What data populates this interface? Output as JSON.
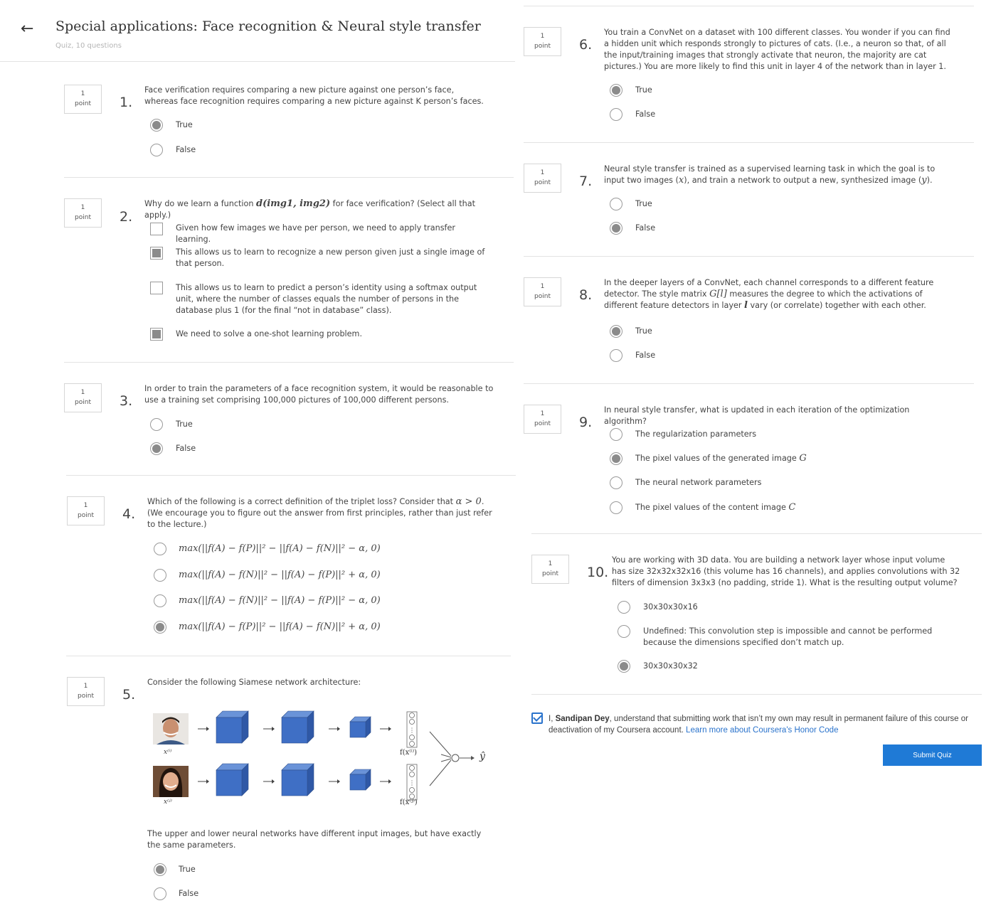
{
  "header": {
    "title": "Special applications: Face recognition & Neural style transfer",
    "subtitle": "Quiz, 10 questions"
  },
  "points": {
    "value": "1",
    "unit": "point"
  },
  "questions": [
    {
      "num": "1.",
      "text": "Face verification requires comparing a new picture against one person’s face, whereas face recognition requires comparing a new picture against K person’s faces.",
      "options": [
        {
          "label": "True",
          "selected": true
        },
        {
          "label": "False",
          "selected": false
        }
      ]
    },
    {
      "num": "2.",
      "text_pre": "Why do we learn a function ",
      "text_math": "d(img1, img2)",
      "text_post": " for face verification? (Select all that apply.)",
      "options": [
        {
          "label": "Given how few images we have per person, we need to apply transfer learning.",
          "selected": false
        },
        {
          "label": "This allows us to learn to recognize a new person given just a single image of that person.",
          "selected": true
        },
        {
          "label": "This allows us to learn to predict a person’s identity using a softmax output unit, where the number of classes equals the number of persons in the database plus 1 (for the final “not in database” class).",
          "selected": false
        },
        {
          "label": "We need to solve a one-shot learning problem.",
          "selected": true
        }
      ]
    },
    {
      "num": "3.",
      "text": "In order to train the parameters of a face recognition system, it would be reasonable to use a training set comprising 100,000 pictures of 100,000 different persons.",
      "options": [
        {
          "label": "True",
          "selected": false
        },
        {
          "label": "False",
          "selected": true
        }
      ]
    },
    {
      "num": "4.",
      "text_pre": "Which of the following is a correct definition of the triplet loss? Consider that ",
      "text_math": "α > 0",
      "text_post": ". (We encourage you to figure out the answer from first principles, rather than just refer to the lecture.)",
      "options": [
        {
          "label": "max(||f(A) − f(P)||² − ||f(A) − f(N)||² − α, 0)",
          "selected": false
        },
        {
          "label": "max(||f(A) − f(N)||² − ||f(A) − f(P)||² + α, 0)",
          "selected": false
        },
        {
          "label": "max(||f(A) − f(N)||² − ||f(A) − f(P)||² − α, 0)",
          "selected": false
        },
        {
          "label": "max(||f(A) − f(P)||² − ||f(A) − f(N)||² + α, 0)",
          "selected": true
        }
      ]
    },
    {
      "num": "5.",
      "text": "Consider the following Siamese network architecture:",
      "diagram": {
        "x_top": "x⁽ⁱ⁾",
        "x_bottom": "x⁽ʲ⁾",
        "f_top": "f(x⁽ⁱ⁾)",
        "f_bottom": "f(x⁽ʲ⁾)",
        "y_hat": "ŷ"
      },
      "text2": "The upper and lower neural networks have different input images, but have exactly the same parameters.",
      "options": [
        {
          "label": "True",
          "selected": true
        },
        {
          "label": "False",
          "selected": false
        }
      ]
    },
    {
      "num": "6.",
      "text": "You train a ConvNet on a dataset with 100 different classes. You wonder if you can find a hidden unit which responds strongly to pictures of cats. (I.e., a neuron so that, of all the input/training images that strongly activate that neuron, the majority are cat pictures.) You are more likely to find this unit in layer 4 of the network than in layer 1.",
      "options": [
        {
          "label": "True",
          "selected": true
        },
        {
          "label": "False",
          "selected": false
        }
      ]
    },
    {
      "num": "7.",
      "text_pre": "Neural style transfer is trained as a supervised learning task in which the goal is to input two images (",
      "text_math": "x",
      "text_mid": "), and train a network to output a new, synthesized image (",
      "text_math2": "y",
      "text_post": ").",
      "options": [
        {
          "label": "True",
          "selected": false
        },
        {
          "label": "False",
          "selected": true
        }
      ]
    },
    {
      "num": "8.",
      "text_pre": "In the deeper layers of a ConvNet, each channel corresponds to a different feature detector. The style matrix ",
      "text_math": "G[l]",
      "text_mid": " measures the degree to which the activations of different feature detectors in layer ",
      "text_math2": "l",
      "text_post": " vary (or correlate) together with each other.",
      "options": [
        {
          "label": "True",
          "selected": true
        },
        {
          "label": "False",
          "selected": false
        }
      ]
    },
    {
      "num": "9.",
      "text": "In neural style transfer, what is updated in each iteration of the optimization algorithm?",
      "options": [
        {
          "label": "The regularization parameters",
          "selected": false
        },
        {
          "label_pre": "The pixel values of the generated image ",
          "math": "G",
          "selected": true
        },
        {
          "label": "The neural network parameters",
          "selected": false
        },
        {
          "label_pre": "The pixel values of the content image ",
          "math": "C",
          "selected": false
        }
      ]
    },
    {
      "num": "10.",
      "text": "You are working with 3D data. You are building a network layer whose input volume has size 32x32x32x16 (this volume has 16 channels), and applies convolutions with 32 filters of dimension 3x3x3 (no padding, stride 1). What is the resulting output volume?",
      "options": [
        {
          "label": "30x30x30x16",
          "selected": false
        },
        {
          "label": "Undefined: This convolution step is impossible and cannot be performed because the dimensions specified don’t match up.",
          "selected": false
        },
        {
          "label": "30x30x30x32",
          "selected": true
        }
      ]
    }
  ],
  "honor": {
    "prefix": "I, ",
    "name": "Sandipan Dey",
    "text": ", understand that submitting work that isn’t my own may result in permanent failure of this course or deactivation of my Coursera account. ",
    "link": "Learn more about Coursera's Honor Code",
    "checked": true
  },
  "submit_label": "Submit Quiz",
  "colors": {
    "accent": "#1f7ad6",
    "selected": "#8b8b8b",
    "network": "#3f6fc5"
  }
}
